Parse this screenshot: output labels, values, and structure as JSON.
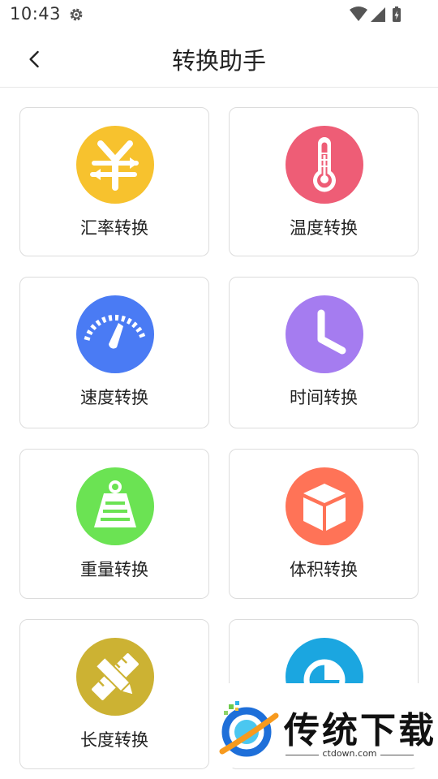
{
  "status_bar": {
    "time": "10:43",
    "icons": [
      "gear-icon",
      "wifi-icon",
      "cell-signal-icon",
      "battery-charging-icon"
    ]
  },
  "app_bar": {
    "back_icon": "chevron-left-icon",
    "title": "转换助手"
  },
  "tools": [
    {
      "label": "汇率转换",
      "icon": "yen-exchange-icon",
      "color": "#F7C22E"
    },
    {
      "label": "温度转换",
      "icon": "thermometer-icon",
      "color": "#EE5D76"
    },
    {
      "label": "速度转换",
      "icon": "speedometer-icon",
      "color": "#4A7BF4"
    },
    {
      "label": "时间转换",
      "icon": "clock-icon",
      "color": "#A57CF0"
    },
    {
      "label": "重量转换",
      "icon": "weight-icon",
      "color": "#6BE353"
    },
    {
      "label": "体积转换",
      "icon": "cube-icon",
      "color": "#FF7357"
    },
    {
      "label": "长度转换",
      "icon": "ruler-pencil-icon",
      "color": "#CCB233"
    },
    {
      "label": "",
      "icon": "area-chart-icon",
      "color": "#1BA6E0"
    }
  ],
  "watermark": {
    "brand": "传统下载",
    "domain": "ctdown.com"
  }
}
